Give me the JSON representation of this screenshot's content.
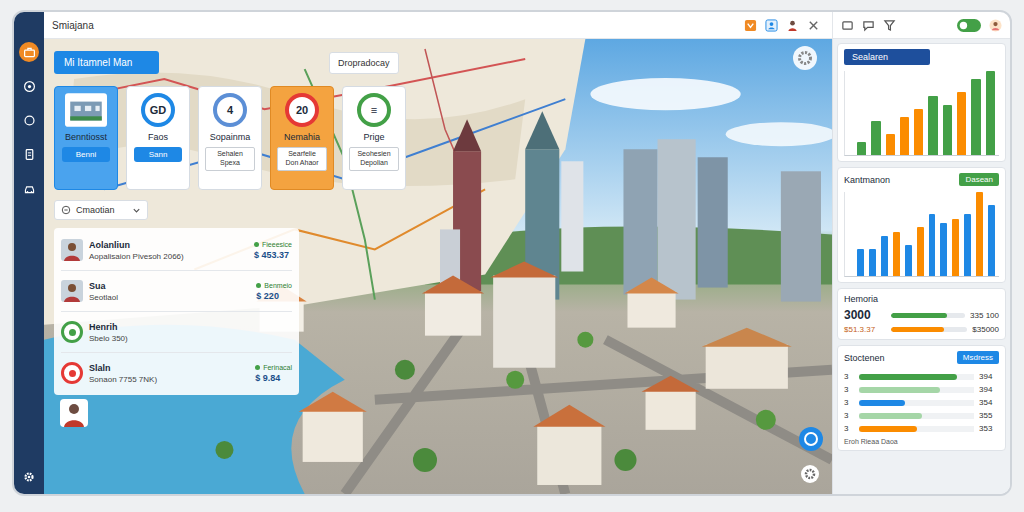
{
  "window": {
    "title": "Smiajana"
  },
  "sidebar": {
    "items": [
      {
        "selected": true
      },
      {
        "selected": false
      },
      {
        "selected": false
      },
      {
        "selected": false
      },
      {
        "selected": false
      }
    ]
  },
  "map": {
    "badge": "Mi Itamnel Man",
    "tag": "Dropradocay"
  },
  "cards": [
    {
      "kind": "image",
      "label": "Benntiosst",
      "button": "Benni",
      "color": "#1e88e5",
      "selected": false
    },
    {
      "kind": "ring",
      "value": "GD",
      "label": "Faos",
      "button": "Sann",
      "color": "#1e88e5",
      "selected": false
    },
    {
      "kind": "ring",
      "value": "4",
      "label": "Sopainma",
      "note": "Sehalen Spexa",
      "color": "#5c8fd6",
      "selected": false
    },
    {
      "kind": "ring",
      "value": "20",
      "label": "Nemahia",
      "note": "Searfelie Don Ahaor",
      "color": "#e53935",
      "selected": true
    },
    {
      "kind": "ring",
      "value": "≡",
      "label": "Prige",
      "note": "Seohesien Depolian",
      "color": "#43a047",
      "selected": false
    }
  ],
  "dropdown": {
    "label": "Cmaotian"
  },
  "people": [
    {
      "name": "Aolanliun",
      "detail": "Aopalisaion Pivesoh 2066)",
      "tag": "Fieeesice",
      "amount": "$ 453.37",
      "kind": "photo"
    },
    {
      "name": "Sua",
      "detail": "Seotlaol",
      "tag": "Benmeio",
      "amount": "$ 220",
      "kind": "photo"
    },
    {
      "name": "Henrih",
      "detail": "Sbelo 350)",
      "kind": "badge",
      "color": "#43a047"
    },
    {
      "name": "Slaln",
      "detail": "Sonaon 7755 7NK)",
      "tag": "Ferinacal",
      "amount": "$ 9.84",
      "kind": "badge",
      "color": "#e53935"
    }
  ],
  "panels": {
    "sales": {
      "title": "Sealaren",
      "bars": [
        {
          "value": 1.5,
          "color": "#43a047"
        },
        {
          "value": 4,
          "color": "#43a047"
        },
        {
          "value": 2.5,
          "color": "#fb8c00"
        },
        {
          "value": 4.5,
          "color": "#fb8c00"
        },
        {
          "value": 5.5,
          "color": "#fb8c00"
        },
        {
          "value": 7,
          "color": "#43a047"
        },
        {
          "value": 6,
          "color": "#43a047"
        },
        {
          "value": 7.5,
          "color": "#fb8c00"
        },
        {
          "value": 9,
          "color": "#43a047"
        },
        {
          "value": 10,
          "color": "#43a047"
        }
      ]
    },
    "maintenance": {
      "title": "Kantmanon",
      "button": "Dasean",
      "bars": [
        {
          "value": 3,
          "color": "#1e88e5"
        },
        {
          "value": 3,
          "color": "#1e88e5"
        },
        {
          "value": 4.5,
          "color": "#1e88e5"
        },
        {
          "value": 5,
          "color": "#fb8c00"
        },
        {
          "value": 3.5,
          "color": "#1e88e5"
        },
        {
          "value": 5.5,
          "color": "#fb8c00"
        },
        {
          "value": 7,
          "color": "#1e88e5"
        },
        {
          "value": 6,
          "color": "#1e88e5"
        },
        {
          "value": 6.5,
          "color": "#fb8c00"
        },
        {
          "value": 7,
          "color": "#1e88e5"
        },
        {
          "value": 9.5,
          "color": "#fb8c00"
        },
        {
          "value": 8,
          "color": "#1e88e5"
        }
      ]
    },
    "memoria": {
      "title": "Hemoria",
      "rows": [
        {
          "value": "3000",
          "reading": "335 100",
          "level": 0.75,
          "color": "#43a047"
        },
        {
          "value": "$51.3.37",
          "reading": "$35000",
          "level": 0.7,
          "color": "#fb8c00"
        }
      ]
    },
    "stock": {
      "title": "Stoctenen",
      "button": "Msdress",
      "rows": [
        {
          "label": "3",
          "level": 0.85,
          "reading": "394",
          "color": "#43a047"
        },
        {
          "label": "3",
          "level": 0.7,
          "reading": "394",
          "color": "#a5d6a7"
        },
        {
          "label": "3",
          "level": 0.4,
          "reading": "354",
          "color": "#1e88e5"
        },
        {
          "label": "3",
          "level": 0.55,
          "reading": "355",
          "color": "#a5d6a7"
        },
        {
          "label": "3",
          "level": 0.5,
          "reading": "353",
          "color": "#fb8c00"
        }
      ],
      "footer": "Eroh Rieaa Daoa"
    }
  }
}
